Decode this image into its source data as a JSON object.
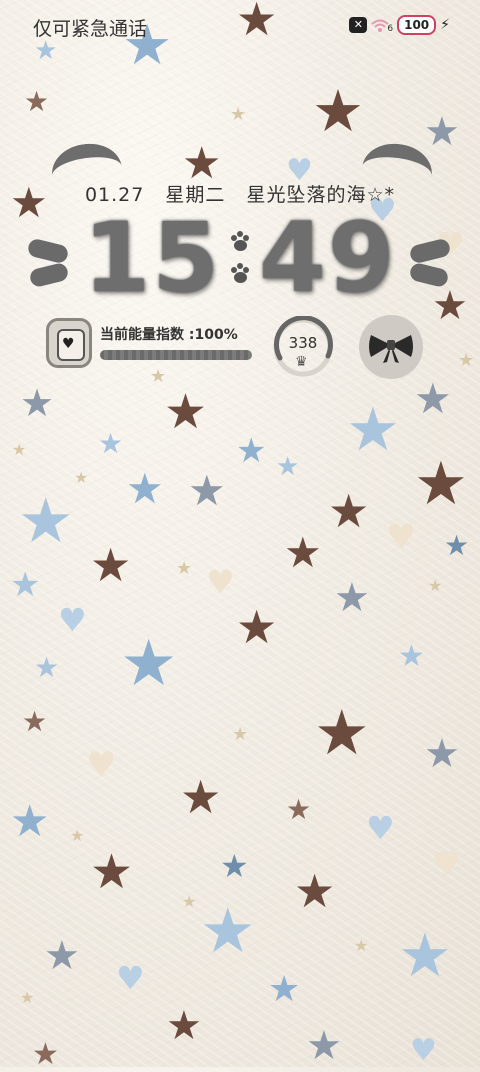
{
  "status_bar": {
    "carrier": "仅可紧急通话",
    "icons": [
      "signal-blocked-icon",
      "wifi-icon"
    ],
    "battery": "100",
    "wifi_badge": "6"
  },
  "date_line": {
    "date": "01.27",
    "weekday": "星期二",
    "caption": "星光坠落的海☆*"
  },
  "clock": {
    "hours": "15",
    "minutes": "49"
  },
  "widgets": {
    "energy_label": "当前能量指数 :100%",
    "energy_level": 1.0,
    "ring_value": "338",
    "ring_icon": "crown-icon",
    "bow_icon": "bow-icon"
  },
  "colors": {
    "fur_grey": "#6e6e6e",
    "background": "#f1ece3",
    "battery_accent": "#d04060"
  }
}
